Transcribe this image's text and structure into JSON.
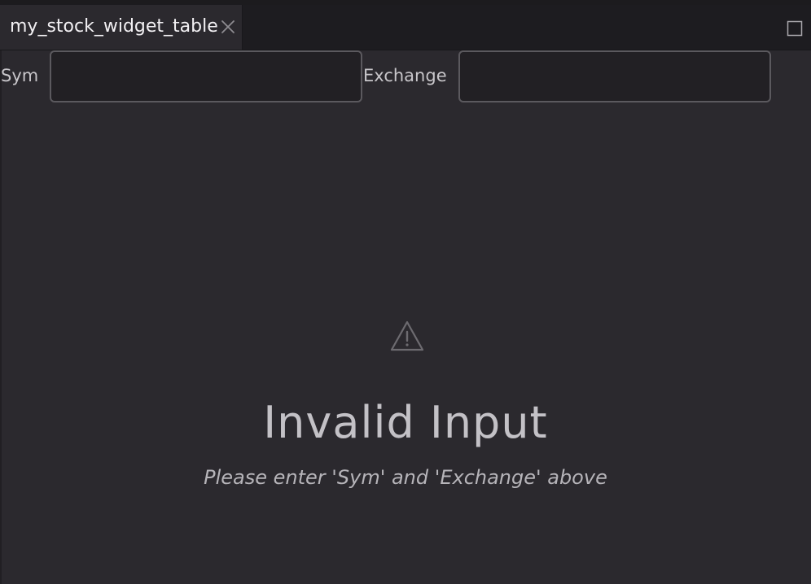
{
  "tab": {
    "title": "my_stock_widget_table",
    "close_icon": "close-icon"
  },
  "panel": {
    "maximize_icon": "maximize-icon"
  },
  "form": {
    "sym_label": "Sym",
    "sym_value": "",
    "exchange_label": "Exchange",
    "exchange_value": ""
  },
  "empty_state": {
    "icon": "warning-icon",
    "title": "Invalid Input",
    "message": "Please enter 'Sym' and 'Exchange' above"
  },
  "colors": {
    "background": "#2b292e",
    "tabbar": "#1d1c20",
    "input_border": "#5b595e",
    "text_primary": "#f2f0f3",
    "text_muted": "#c3c1c6"
  }
}
